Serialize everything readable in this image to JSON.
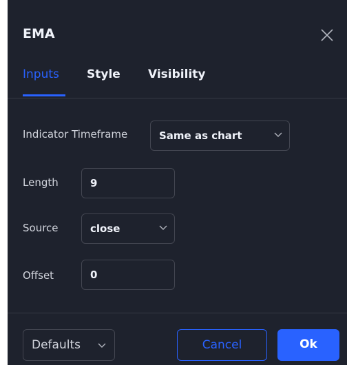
{
  "dialog": {
    "title": "EMA",
    "close_icon": "close-icon"
  },
  "tabs": [
    {
      "label": "Inputs",
      "active": true
    },
    {
      "label": "Style",
      "active": false
    },
    {
      "label": "Visibility",
      "active": false
    }
  ],
  "inputs": {
    "timeframe": {
      "label": "Indicator Timeframe",
      "value": "Same as chart"
    },
    "length": {
      "label": "Length",
      "value": "9"
    },
    "source": {
      "label": "Source",
      "value": "close"
    },
    "offset": {
      "label": "Offset",
      "value": "0"
    }
  },
  "footer": {
    "defaults_label": "Defaults",
    "cancel_label": "Cancel",
    "ok_label": "Ok"
  },
  "colors": {
    "background": "#1e222d",
    "accent": "#2962ff",
    "text": "#d1d4dc",
    "border": "#434651"
  }
}
